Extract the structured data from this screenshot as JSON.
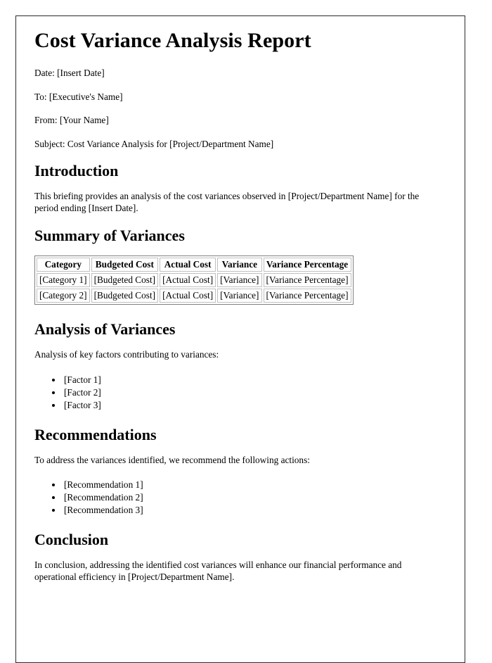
{
  "document": {
    "title": "Cost Variance Analysis Report",
    "meta": [
      {
        "label": "Date:",
        "value": "[Insert Date]",
        "full": "Date: [Insert Date]"
      },
      {
        "label": "To:",
        "value": "[Executive's Name]",
        "full": "To: [Executive's Name]"
      },
      {
        "label": "From:",
        "value": "[Your Name]",
        "full": "From: [Your Name]"
      },
      {
        "label": "Subject:",
        "value": "Cost Variance Analysis for [Project/Department Name]",
        "full": "Subject: Cost Variance Analysis for [Project/Department Name]"
      }
    ],
    "sections": {
      "introduction": {
        "heading": "Introduction",
        "paragraph": "This briefing provides an analysis of the cost variances observed in [Project/Department Name] for the period ending [Insert Date]."
      },
      "summary": {
        "heading": "Summary of Variances",
        "table": {
          "columns": [
            "Category",
            "Budgeted Cost",
            "Actual Cost",
            "Variance",
            "Variance Percentage"
          ],
          "rows": [
            [
              "[Category 1]",
              "[Budgeted Cost]",
              "[Actual Cost]",
              "[Variance]",
              "[Variance Percentage]"
            ],
            [
              "[Category 2]",
              "[Budgeted Cost]",
              "[Actual Cost]",
              "[Variance]",
              "[Variance Percentage]"
            ]
          ]
        }
      },
      "analysis": {
        "heading": "Analysis of Variances",
        "paragraph": "Analysis of key factors contributing to variances:",
        "items": [
          "[Factor 1]",
          "[Factor 2]",
          "[Factor 3]"
        ]
      },
      "recommendations": {
        "heading": "Recommendations",
        "paragraph": "To address the variances identified, we recommend the following actions:",
        "items": [
          "[Recommendation 1]",
          "[Recommendation 2]",
          "[Recommendation 3]"
        ]
      },
      "conclusion": {
        "heading": "Conclusion",
        "paragraph": "In conclusion, addressing the identified cost variances will enhance our financial performance and operational efficiency in [Project/Department Name]."
      }
    }
  },
  "style": {
    "page_border_color": "#2b2b2b",
    "text_color": "#000000",
    "background_color": "#ffffff",
    "table_outer_border_color": "#808080",
    "table_cell_border_color": "#c0c0c0"
  }
}
